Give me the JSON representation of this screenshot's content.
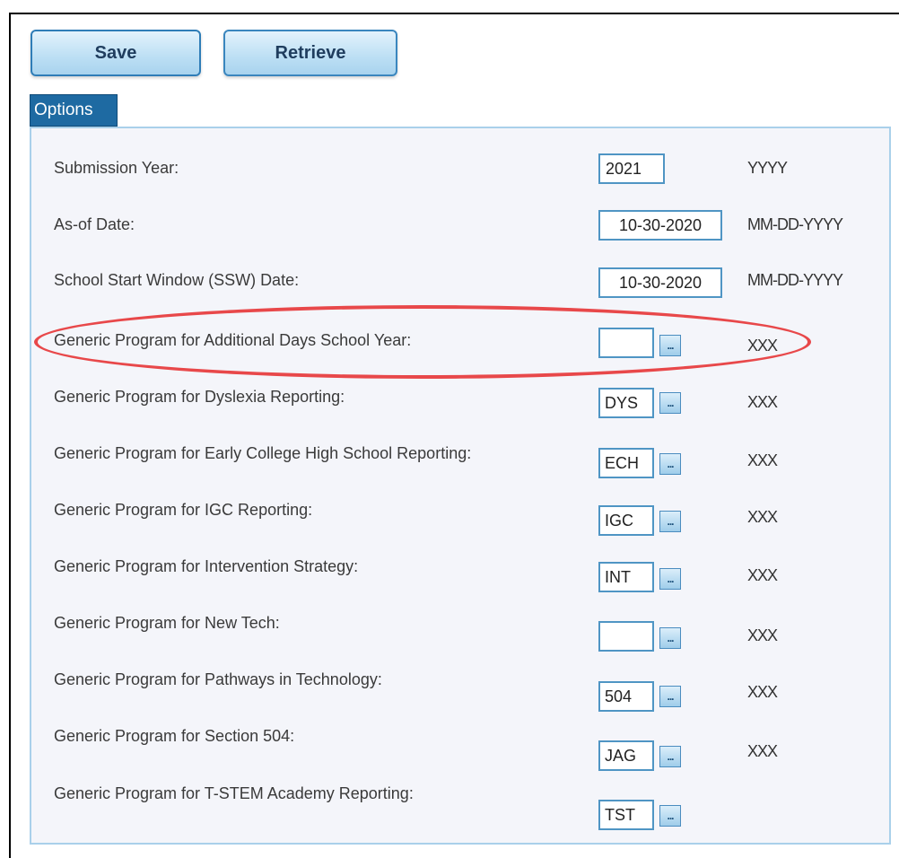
{
  "toolbar": {
    "save_label": "Save",
    "retrieve_label": "Retrieve"
  },
  "options": {
    "tab_label": "Options",
    "rows": [
      {
        "label": "Submission Year:",
        "value": "2021",
        "hint": "YYYY"
      },
      {
        "label": "As-of Date:",
        "value": "10-30-2020",
        "hint": "MM-DD-YYYY"
      },
      {
        "label": "School Start Window (SSW) Date:",
        "value": "10-30-2020",
        "hint": "MM-DD-YYYY"
      },
      {
        "label": "Generic Program for Additional Days School Year:",
        "value": "",
        "hint": "XXX"
      },
      {
        "label": "Generic Program for Dyslexia Reporting:",
        "value": "DYS",
        "hint": "XXX"
      },
      {
        "label": "Generic Program for Early College High School Reporting:",
        "value": "ECH",
        "hint": "XXX"
      },
      {
        "label": "Generic Program for IGC Reporting:",
        "value": "IGC",
        "hint": "XXX"
      },
      {
        "label": "Generic Program for Intervention Strategy:",
        "value": "INT",
        "hint": "XXX"
      },
      {
        "label": "Generic Program for New Tech:",
        "value": "",
        "hint": "XXX"
      },
      {
        "label": "Generic Program for Pathways in Technology:",
        "value": "504",
        "hint": "XXX"
      },
      {
        "label": "Generic Program for Section 504:",
        "value": "JAG",
        "hint": "XXX"
      },
      {
        "label": "Generic Program for T-STEM Academy Reporting:",
        "value": "TST",
        "hint": ""
      }
    ],
    "lookup_glyph": "..."
  },
  "colors": {
    "accent": "#1e6aa2",
    "highlight": "#e8484a"
  },
  "icons": {
    "lookup": "ellipsis-lookup-icon"
  }
}
